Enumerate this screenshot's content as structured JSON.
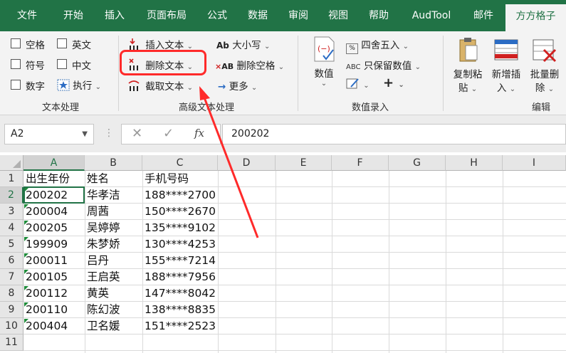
{
  "tabs": [
    "文件",
    "开始",
    "插入",
    "页面布局",
    "公式",
    "数据",
    "审阅",
    "视图",
    "帮助",
    "AudTool",
    "邮件",
    "方方格子"
  ],
  "ribbon": {
    "checkboxes": [
      "空格",
      "英文",
      "符号",
      "中文",
      "数字"
    ],
    "execute_label": "执行",
    "insert_text": "插入文本",
    "delete_text": "删除文本",
    "extract_text": "截取文本",
    "case_label": "大小写",
    "delete_spaces": "删除空格",
    "more_label": "更多",
    "round_label": "四舍五入",
    "keep_values": "只保留数值",
    "value_label": "数值",
    "copy_paste": [
      "复制粘",
      "贴"
    ],
    "new_insert": [
      "新增插",
      "入"
    ],
    "batch_delete": [
      "批量删",
      "除"
    ],
    "groups": [
      "文本处理",
      "高级文本处理",
      "数值录入",
      "编辑"
    ]
  },
  "formula_bar": {
    "name_box": "A2",
    "fx_label": "fx",
    "formula_value": "200202"
  },
  "columns": [
    "A",
    "B",
    "C",
    "D",
    "E",
    "F",
    "G",
    "H",
    "I"
  ],
  "rows": [
    "1",
    "2",
    "3",
    "4",
    "5",
    "6",
    "7",
    "8",
    "9",
    "10",
    "11"
  ],
  "table": {
    "headers": [
      "出生年份",
      "姓名",
      "手机号码"
    ],
    "data": [
      [
        "200202",
        "华孝洁",
        "188****2700"
      ],
      [
        "200004",
        "周茜",
        "150****2670"
      ],
      [
        "200205",
        "吴婷婷",
        "135****9102"
      ],
      [
        "199909",
        "朱梦娇",
        "130****4253"
      ],
      [
        "200011",
        "吕丹",
        "155****7214"
      ],
      [
        "200105",
        "王启英",
        "188****7956"
      ],
      [
        "200112",
        "黄英",
        "147****8042"
      ],
      [
        "200110",
        "陈幻波",
        "138****8835"
      ],
      [
        "200404",
        "卫名媛",
        "151****2523"
      ]
    ]
  },
  "colors": {
    "excel_green": "#217346",
    "highlight_red": "#ff2a2a",
    "error_triangle": "#1e8c3a"
  }
}
